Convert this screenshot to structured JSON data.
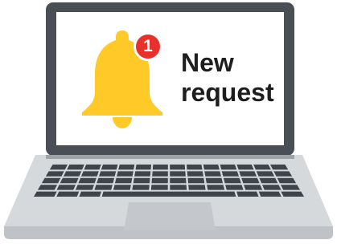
{
  "notification": {
    "badge_count": "1",
    "message_line1": "New",
    "message_line2": "request",
    "icon": "bell-icon"
  },
  "colors": {
    "bell": "#FFC928",
    "badge": "#E8312C",
    "lid": "#4A4F55",
    "base": "#D6D9DC",
    "keys": "#3F444A",
    "touchpad": "#C4C8CC"
  }
}
